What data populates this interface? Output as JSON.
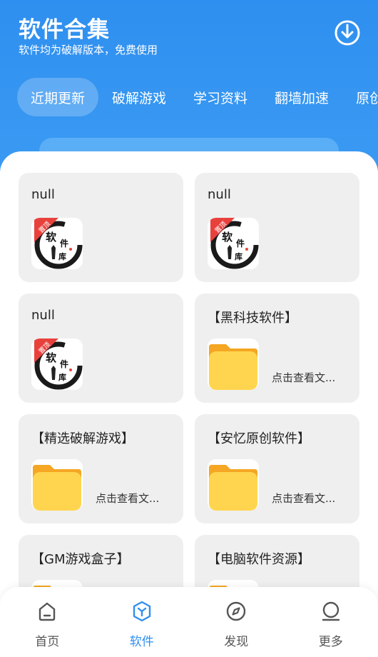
{
  "header": {
    "title": "软件合集",
    "subtitle": "软件均为破解版本，免费使用",
    "download_icon": "download-icon"
  },
  "tabs": [
    {
      "label": "近期更新",
      "active": true
    },
    {
      "label": "破解游戏",
      "active": false
    },
    {
      "label": "学习资料",
      "active": false
    },
    {
      "label": "翻墙加速",
      "active": false
    },
    {
      "label": "原创",
      "active": false
    }
  ],
  "cards": [
    {
      "title": "null",
      "thumb": "software-library-logo",
      "badge": "置顶",
      "caption": ""
    },
    {
      "title": "null",
      "thumb": "software-library-logo",
      "badge": "置顶",
      "caption": ""
    },
    {
      "title": "null",
      "thumb": "software-library-logo",
      "badge": "置顶",
      "caption": ""
    },
    {
      "title": "【黑科技软件】",
      "thumb": "folder-icon",
      "badge": "",
      "caption": "点击查看文..."
    },
    {
      "title": "【精选破解游戏】",
      "thumb": "folder-icon",
      "badge": "",
      "caption": "点击查看文..."
    },
    {
      "title": "【安忆原创软件】",
      "thumb": "folder-icon",
      "badge": "",
      "caption": "点击查看文..."
    },
    {
      "title": "【GM游戏盒子】",
      "thumb": "folder-icon",
      "badge": "",
      "caption": ""
    },
    {
      "title": "【电脑软件资源】",
      "thumb": "folder-icon",
      "badge": "",
      "caption": ""
    }
  ],
  "logo_text": {
    "ruan": "软",
    "jian": "件",
    "ku": "库"
  },
  "bottom_nav": [
    {
      "label": "首页",
      "icon": "home-icon",
      "active": false
    },
    {
      "label": "软件",
      "icon": "cube-icon",
      "active": true
    },
    {
      "label": "发现",
      "icon": "compass-icon",
      "active": false
    },
    {
      "label": "更多",
      "icon": "user-icon",
      "active": false
    }
  ],
  "colors": {
    "primary": "#2f8ff0",
    "card_bg": "#efefef",
    "folder_yellow": "#ffd54f",
    "badge_red": "#e8413c"
  }
}
